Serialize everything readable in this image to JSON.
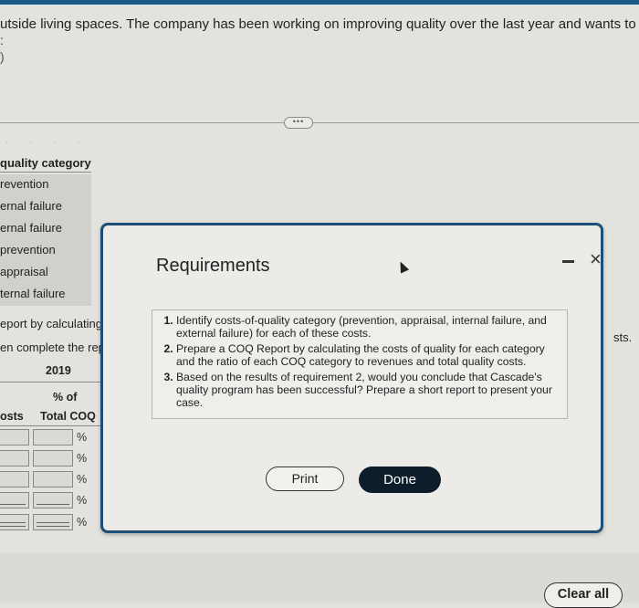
{
  "problem": {
    "intro_line": "utside living spaces. The company has been working on improving quality over the last year and wants to evaluate how we",
    "intro_line2": ":",
    "intro_line3": ")",
    "more_button": "•••"
  },
  "quality_table": {
    "header": "quality category",
    "items": [
      "revention",
      "ernal failure",
      "ernal failure",
      "prevention",
      "appraisal",
      "ternal failure"
    ]
  },
  "report_section": {
    "line1": "eport by calculating th",
    "line2": "en complete the repo",
    "year": "2019",
    "col_pct_of": "% of",
    "col_costs": "osts",
    "col_total_coq": "Total COQ",
    "pct_symbol": "%",
    "rows": [
      {
        "underline": "none"
      },
      {
        "underline": "none"
      },
      {
        "underline": "none"
      },
      {
        "underline": "single"
      },
      {
        "underline": "double"
      }
    ],
    "outside_right_text": "sts."
  },
  "modal": {
    "title": "Requirements",
    "minimize_icon": "minimize-icon",
    "close_icon": "×",
    "requirements": [
      "Identify costs-of-quality category (prevention, appraisal, internal failure, and external failure) for each of these costs.",
      "Prepare a COQ Report by calculating the costs of quality for each category and the ratio of each COQ category to revenues and total quality costs.",
      "Based on the results of requirement 2, would you conclude that Cascade's quality program has been successful? Prepare a short report to present your case."
    ],
    "print_label": "Print",
    "done_label": "Done"
  },
  "footer": {
    "clear_all_label": "Clear all"
  },
  "colors": {
    "modal_border": "#1d4f78",
    "done_button": "#0e1d2c",
    "top_bar": "#1a5a86"
  }
}
